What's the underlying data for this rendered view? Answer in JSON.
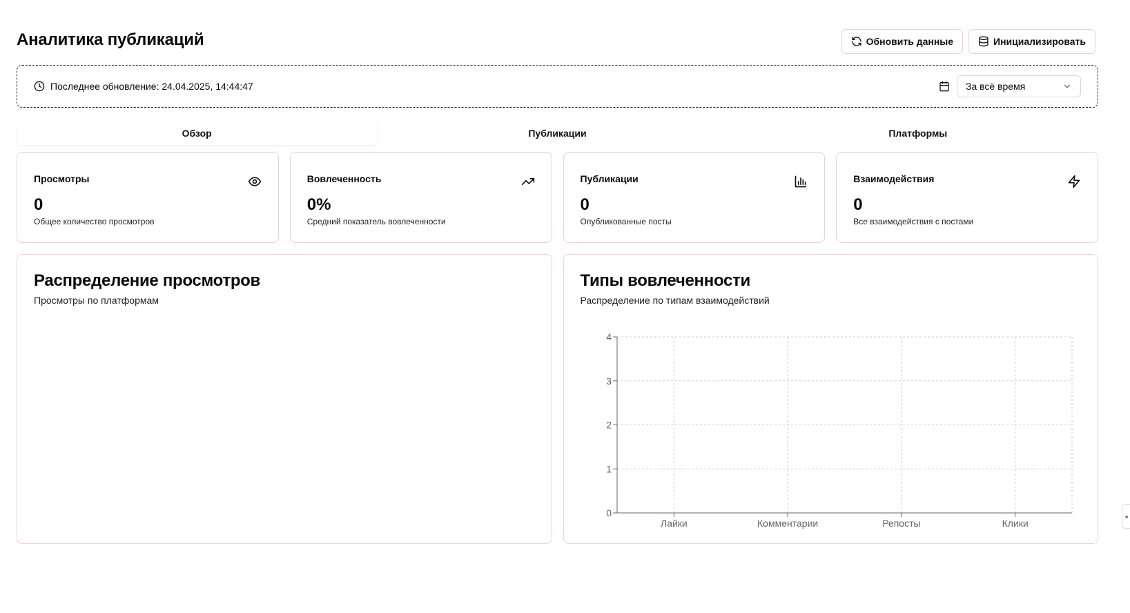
{
  "header": {
    "title": "Аналитика публикаций",
    "refresh_label": "Обновить данные",
    "init_label": "Инициализировать"
  },
  "status": {
    "last_update": "Последнее обновление: 24.04.2025, 14:44:47",
    "period_value": "За всё время"
  },
  "tabs": [
    {
      "label": "Обзор",
      "active": true
    },
    {
      "label": "Публикации",
      "active": false
    },
    {
      "label": "Платформы",
      "active": false
    }
  ],
  "stats": [
    {
      "title": "Просмотры",
      "value": "0",
      "desc": "Общее количество просмотров",
      "icon": "eye-icon"
    },
    {
      "title": "Вовлеченность",
      "value": "0%",
      "desc": "Средний показатель вовлеченности",
      "icon": "trending-up-icon"
    },
    {
      "title": "Публикации",
      "value": "0",
      "desc": "Опубликованные посты",
      "icon": "bar-chart-icon"
    },
    {
      "title": "Взаимодействия",
      "value": "0",
      "desc": "Все взаимодействия с постами",
      "icon": "zap-icon"
    }
  ],
  "views_panel": {
    "title": "Распределение просмотров",
    "subtitle": "Просмотры по платформам"
  },
  "engagement_panel": {
    "title": "Типы вовлеченности",
    "subtitle": "Распределение по типам взаимодействий"
  },
  "chart_data": {
    "type": "bar",
    "categories": [
      "Лайки",
      "Комментарии",
      "Репосты",
      "Клики"
    ],
    "values": [
      0,
      0,
      0,
      0
    ],
    "yticks": [
      0,
      1,
      2,
      3,
      4
    ],
    "ylim": [
      0,
      4
    ],
    "grid": true,
    "colors": {
      "axis": "#666666",
      "grid": "#cccccc",
      "border": "#f2cdd7"
    }
  }
}
